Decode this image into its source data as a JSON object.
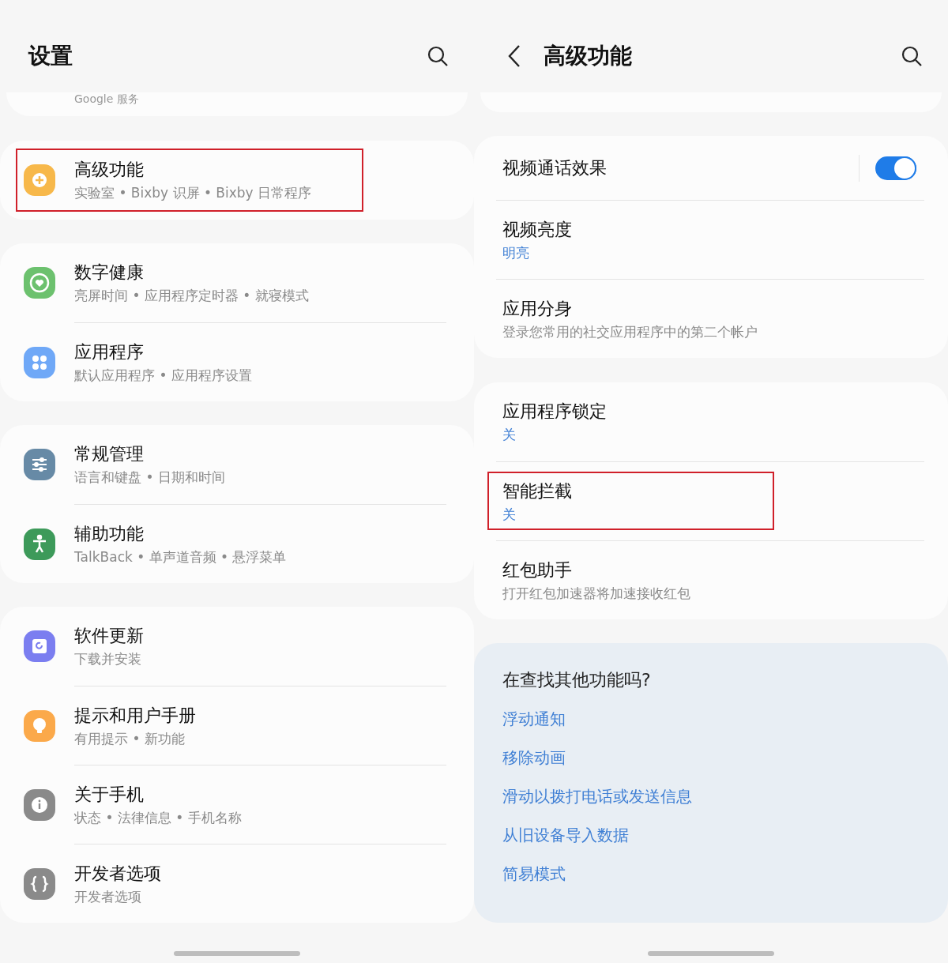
{
  "left": {
    "title": "设置",
    "partial_item": "Google 服务",
    "groups": [
      {
        "items": [
          {
            "title": "高级功能",
            "subtitle": "实验室 • Bixby 识屏 • Bixby 日常程序",
            "color": "#f7b84a",
            "highlighted": true
          }
        ]
      },
      {
        "items": [
          {
            "title": "数字健康",
            "subtitle": "亮屏时间 • 应用程序定时器 • 就寝模式",
            "color": "#6cc16e",
            "highlighted": false
          },
          {
            "title": "应用程序",
            "subtitle": "默认应用程序 • 应用程序设置",
            "color": "#6fa8f7",
            "highlighted": false
          }
        ]
      },
      {
        "items": [
          {
            "title": "常规管理",
            "subtitle": "语言和键盘 • 日期和时间",
            "color": "#678aa6",
            "highlighted": false
          },
          {
            "title": "辅助功能",
            "subtitle": "TalkBack • 单声道音频 • 悬浮菜单",
            "color": "#3d9a5a",
            "highlighted": false
          }
        ]
      },
      {
        "items": [
          {
            "title": "软件更新",
            "subtitle": "下载并安装",
            "color": "#7b7ef0",
            "highlighted": false
          },
          {
            "title": "提示和用户手册",
            "subtitle": "有用提示 • 新功能",
            "color": "#fba94a",
            "highlighted": false
          },
          {
            "title": "关于手机",
            "subtitle": "状态 • 法律信息 • 手机名称",
            "color": "#8a8a8a",
            "highlighted": false
          },
          {
            "title": "开发者选项",
            "subtitle": "开发者选项",
            "color": "#8a8a8a",
            "highlighted": false
          }
        ]
      }
    ]
  },
  "right": {
    "title": "高级功能",
    "groups": [
      {
        "items": [
          {
            "kind": "toggle",
            "title": "视频通话效果",
            "on": true,
            "highlighted": false
          },
          {
            "kind": "value",
            "title": "视频亮度",
            "subtitle": "明亮",
            "highlighted": false
          },
          {
            "kind": "summary",
            "title": "应用分身",
            "subtitle": "登录您常用的社交应用程序中的第二个帐户",
            "highlighted": false
          }
        ]
      },
      {
        "items": [
          {
            "kind": "value",
            "title": "应用程序锁定",
            "subtitle": "关",
            "highlighted": false
          },
          {
            "kind": "value",
            "title": "智能拦截",
            "subtitle": "关",
            "highlighted": true
          },
          {
            "kind": "summary",
            "title": "红包助手",
            "subtitle": "打开红包加速器将加速接收红包",
            "highlighted": false
          }
        ]
      }
    ],
    "suggestions": {
      "title": "在查找其他功能吗?",
      "links": [
        "浮动通知",
        "移除动画",
        "滑动以拨打电话或发送信息",
        "从旧设备导入数据",
        "简易模式"
      ]
    }
  }
}
